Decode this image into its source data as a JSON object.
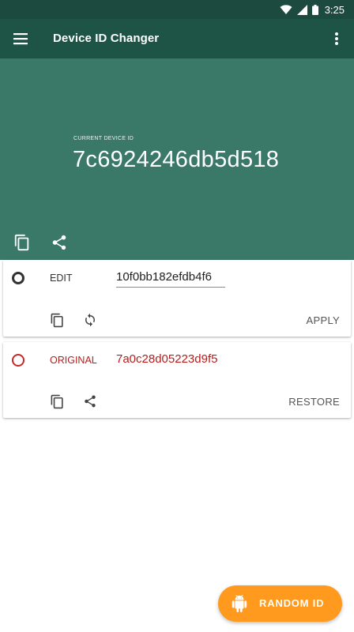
{
  "status_bar": {
    "time": "3:25",
    "icons": [
      "wifi-icon",
      "signal-icon",
      "battery-icon"
    ]
  },
  "app_bar": {
    "title": "Device ID Changer",
    "menu_icon": "hamburger-menu-icon",
    "overflow_icon": "more-vert-icon"
  },
  "hero": {
    "label": "CURRENT DEVICE ID",
    "value": "7c6924246db5d518",
    "actions": [
      "copy-icon",
      "share-icon"
    ]
  },
  "edit_card": {
    "label": "EDIT",
    "value": "10f0bb182efdb4f6",
    "action_label": "APPLY",
    "icons": [
      "copy-icon",
      "refresh-icon"
    ]
  },
  "original_card": {
    "label": "ORIGINAL",
    "value": "7a0c28d05223d9f5",
    "action_label": "RESTORE",
    "icons": [
      "copy-icon",
      "share-icon"
    ]
  },
  "fab": {
    "label": "RANDOM ID",
    "icon": "android-icon"
  },
  "colors": {
    "status_bar": "#1d4a3f",
    "app_bar": "#1e5446",
    "hero": "#3a7967",
    "accent_red": "#c62828",
    "fab": "#ff9a1f"
  }
}
